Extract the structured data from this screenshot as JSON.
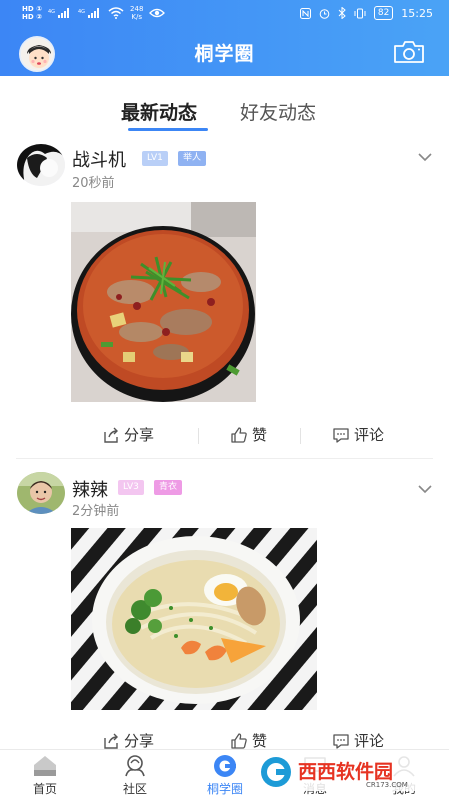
{
  "status_bar": {
    "hd_top": "HD ①",
    "hd_bottom": "HD ②",
    "net_top": "4G",
    "net_bottom": "4G",
    "speed_value": "248",
    "speed_unit": "K/s",
    "battery": "82",
    "time": "15:25"
  },
  "header": {
    "title": "桐学圈",
    "avatar_icon": "user-avatar-icon",
    "camera_icon": "camera-icon"
  },
  "tabs": {
    "latest": "最新动态",
    "friends": "好友动态",
    "active": "latest"
  },
  "posts": [
    {
      "name": "战斗机",
      "level": "LV1",
      "title_badge": "举人",
      "level_color": "#b9cff7",
      "title_badge_color": "#8fb2f2",
      "time": "20秒前",
      "image": "spicy-stew-photo",
      "actions": {
        "share": "分享",
        "like": "赞",
        "comment": "评论"
      }
    },
    {
      "name": "辣辣",
      "level": "LV3",
      "title_badge": "青衣",
      "level_color": "#f3c6f0",
      "title_badge_color": "#ee9be5",
      "time": "2分钟前",
      "image": "noodle-bowl-photo",
      "actions": {
        "share": "分享",
        "like": "赞",
        "comment": "评论"
      }
    }
  ],
  "bottom_nav": [
    {
      "label": "首页",
      "icon": "home-icon"
    },
    {
      "label": "社区",
      "icon": "community-icon"
    },
    {
      "label": "桐学圈",
      "icon": "circle-icon",
      "active": true
    },
    {
      "label": "消息",
      "icon": "message-icon"
    },
    {
      "label": "我的",
      "icon": "profile-icon"
    }
  ],
  "watermark": {
    "brand": "西西软件园",
    "url": "CR173.COM"
  },
  "colors": {
    "accent": "#3c86f5",
    "header_gradient_end": "#4aa3f6"
  }
}
